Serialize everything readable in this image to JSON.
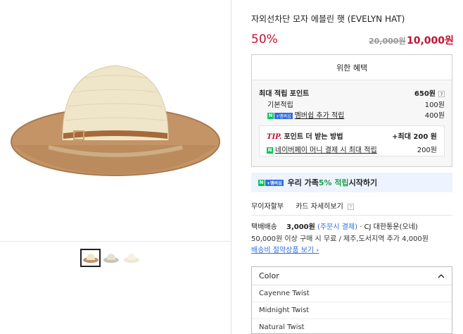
{
  "product": {
    "title": "자외선차단 모자 에블린 햇 (EVELYN HAT)",
    "discount": "50%",
    "original_price": "20,000원",
    "sale_price": "10,000원"
  },
  "benefits": {
    "header": "위한 혜택",
    "max_points_label": "최대 적립 포인트",
    "max_points_value": "650원",
    "help": "?",
    "basic_label": "기본적립",
    "basic_value": "100원",
    "membership_label": "멤버쉽 추가 적립",
    "membership_value": "400원",
    "tip_label": "TIP.",
    "tip_title": "포인트 더 받는 방법",
    "tip_max": "+최대 200 원",
    "tip_item_label": "네이버페이 머니 결제 시 최대 적립",
    "tip_item_value": "200원",
    "np_badge_n": "N",
    "np_badge_plus": "+멤버십"
  },
  "promo": {
    "part1": "우리 가족 ",
    "part2": "5% 적립",
    "part3": " 시작하기"
  },
  "installment": {
    "label1": "무이자할부",
    "label2": "카드 자세히보기",
    "help": "?"
  },
  "shipping": {
    "label": "택배배송",
    "fee": "3,000원",
    "fee_note": "(주문시 결제)",
    "carrier": "· CJ 대한통운(오네)",
    "info": "50,000원 이상 구매 시 무료 / 제주,도서지역 추가 4,000원",
    "link": "배송비 절약상품 보기 ›"
  },
  "options": {
    "header": "Color",
    "items": [
      "Cayenne Twist",
      "Midnight Twist",
      "Natural Twist"
    ]
  },
  "colors": {
    "accent_red": "#c1122f",
    "naver_green": "#03c75a",
    "link_blue": "#2f6fde"
  }
}
